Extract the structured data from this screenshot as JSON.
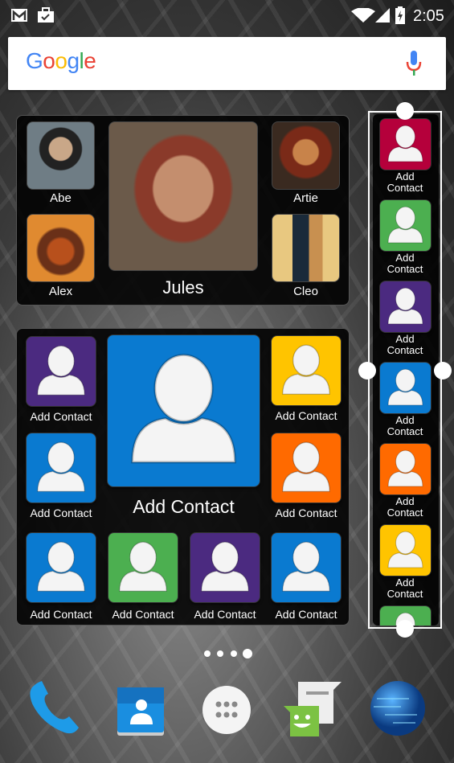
{
  "status_bar": {
    "time": "2:05",
    "icons": [
      "gmail-icon",
      "briefcase-check-icon",
      "wifi-icon",
      "cell-signal-icon",
      "battery-charging-icon"
    ]
  },
  "search": {
    "logo": "Google",
    "mic_icon": "mic-icon"
  },
  "favorites_widget": {
    "contacts": [
      {
        "name": "Abe"
      },
      {
        "name": "Jules"
      },
      {
        "name": "Artie"
      },
      {
        "name": "Alex"
      },
      {
        "name": "Cleo"
      }
    ]
  },
  "grid_widget": {
    "label": "Add Contact",
    "colors": {
      "purple": "#4b2a80",
      "blue": "#0a7ad0",
      "yellow": "#ffc400",
      "orange": "#ff6a00",
      "green": "#4caf50",
      "crimson": "#b5003b"
    }
  },
  "strip_widget": {
    "label_line1": "Add",
    "label_line2": "Contact"
  },
  "page_indicator": {
    "pages": 4,
    "current": 4
  },
  "dock": {
    "apps": [
      "phone-icon",
      "contacts-icon",
      "app-drawer-icon",
      "messenger-icon",
      "browser-globe-icon"
    ]
  }
}
